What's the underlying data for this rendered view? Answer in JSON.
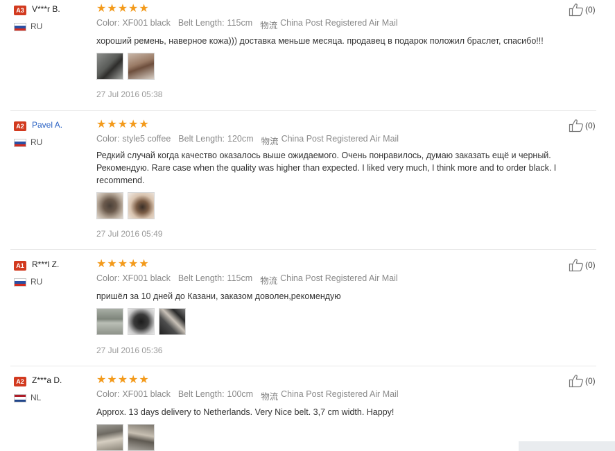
{
  "labels": {
    "color": "Color:",
    "belt_length": "Belt Length:",
    "shipping_icon": "物流",
    "shipping_method": "China Post Registered Air Mail",
    "star_glyph": "★"
  },
  "reviews": [
    {
      "badge": "A3",
      "user": "V***r B.",
      "country": "RU",
      "color_value": "XF001 black",
      "belt_length_value": "115cm",
      "comment": "хороший ремень, наверное кожа))) доставка меньше месяца. продавец в подарок положил браслет, спасибо!!!",
      "date": "27 Jul 2016 05:38",
      "helpful_count": "(0)"
    },
    {
      "badge": "A2",
      "user": "Pavel A.",
      "country": "RU",
      "color_value": "style5 coffee",
      "belt_length_value": "120cm",
      "comment": "Редкий случай когда качество оказалось выше ожидаемого. Очень понравилось, думаю заказать ещё и черный. Рекомендую. Rare case when the quality was higher than expected. I liked very much, I think more and to order black. I recommend.",
      "date": "27 Jul 2016 05:49",
      "helpful_count": "(0)"
    },
    {
      "badge": "A1",
      "user": "R***l Z.",
      "country": "RU",
      "color_value": "XF001 black",
      "belt_length_value": "115cm",
      "comment": "пришёл за 10 дней до Казани, заказом доволен,рекомендую",
      "date": "27 Jul 2016 05:36",
      "helpful_count": "(0)"
    },
    {
      "badge": "A2",
      "user": "Z***a D.",
      "country": "NL",
      "color_value": "XF001 black",
      "belt_length_value": "100cm",
      "comment": "Approx. 13 days delivery to Netherlands. Very Nice belt. 3,7 cm width. Happy!",
      "helpful_count": "(0)"
    }
  ],
  "colors": {
    "badge": "#d23a1f",
    "star": "#f39a1b",
    "link": "#2a62c4",
    "flag_ru": [
      "#ffffff",
      "#2b4fa3",
      "#d52b1e"
    ],
    "flag_nl": [
      "#ae1c28",
      "#ffffff",
      "#21468b"
    ]
  }
}
